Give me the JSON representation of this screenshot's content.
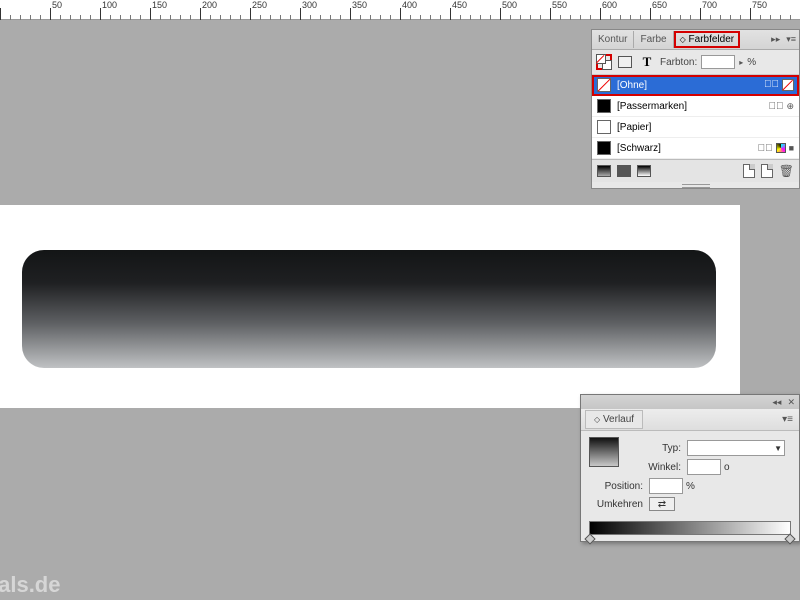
{
  "ruler": {
    "major_step": 50,
    "start": 50,
    "end": 800
  },
  "swatches": {
    "tabs": {
      "kontur": "Kontur",
      "farbe": "Farbe",
      "farbfelder": "Farbfelder"
    },
    "toolbar": {
      "farbton_label": "Farbton:",
      "pct": "%"
    },
    "items": [
      {
        "name": "[Ohne]"
      },
      {
        "name": "[Passermarken]"
      },
      {
        "name": "[Papier]"
      },
      {
        "name": "[Schwarz]"
      }
    ]
  },
  "gradient": {
    "tab": "Verlauf",
    "typ_label": "Typ:",
    "winkel_label": "Winkel:",
    "winkel_suffix": "o",
    "position_label": "Position:",
    "position_suffix": "%",
    "umkehren_label": "Umkehren"
  },
  "watermark": "ials.de"
}
